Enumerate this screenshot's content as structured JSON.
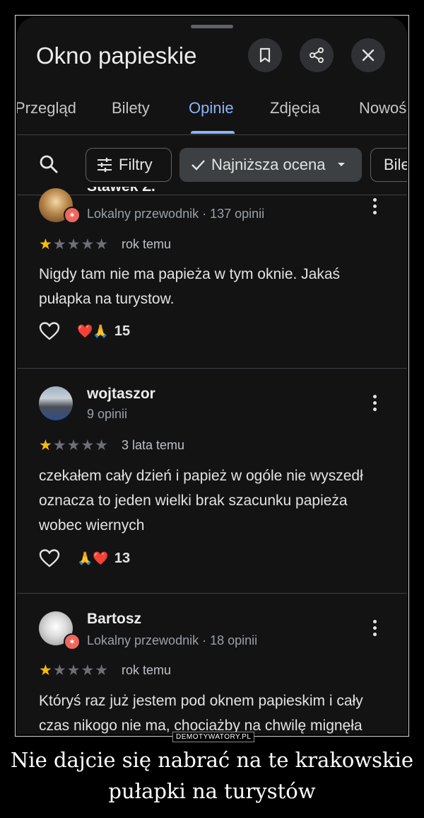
{
  "header": {
    "title": "Okno papieskie",
    "icons": [
      "bookmark-icon",
      "share-icon",
      "close-icon"
    ]
  },
  "tabs": [
    {
      "label": "Przegląd",
      "active": false
    },
    {
      "label": "Bilety",
      "active": false
    },
    {
      "label": "Opinie",
      "active": true
    },
    {
      "label": "Zdjęcia",
      "active": false
    },
    {
      "label": "Nowość",
      "active": false
    }
  ],
  "filters": {
    "filtry_label": "Filtry",
    "sort_label": "Najniższa ocena",
    "extra_label": "Bile"
  },
  "reviews": [
    {
      "name": "Stawek Z.",
      "meta": "Lokalny przewodnik · 137 opinii",
      "rating": 1,
      "time": "rok temu",
      "text": "Nigdy tam nie ma papieża w tym oknie. Jakaś pułapka na turystow.",
      "reaction_emoji": "❤️🙏",
      "reaction_count": "15"
    },
    {
      "name": "wojtaszor",
      "meta": "9 opinii",
      "rating": 1,
      "time": "3 lata temu",
      "text": "czekałem cały dzień i papież w ogóle nie wyszedł oznacza to jeden wielki brak szacunku papieża wobec wiernych",
      "reaction_emoji": "🙏❤️",
      "reaction_count": "13"
    },
    {
      "name": "Bartosz",
      "meta": "Lokalny przewodnik · 18 opinii",
      "rating": 1,
      "time": "rok temu",
      "text": "Któryś raz już jestem pod oknem papieskim i cały czas nikogo nie ma, chociażby na chwilę mignęła"
    }
  ],
  "watermark": "DEMOTYWATORY.PL",
  "caption": "Nie dajcie się nabrać na te krakowskie pułapki na turystów",
  "colors": {
    "accent": "#8ab4f8",
    "star": "#fbbc04",
    "background": "#131314",
    "local_guide_badge": "#ee675c"
  }
}
